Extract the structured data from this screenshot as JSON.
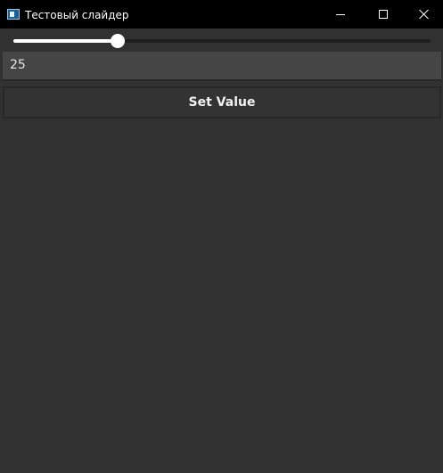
{
  "window": {
    "title": "Тестовый слайдер",
    "controls": {
      "minimize": "minimize-icon",
      "maximize": "maximize-icon",
      "close": "close-icon"
    }
  },
  "slider": {
    "value_fraction": 0.25
  },
  "value_field": {
    "value": "25"
  },
  "set_button": {
    "label": "Set Value"
  }
}
